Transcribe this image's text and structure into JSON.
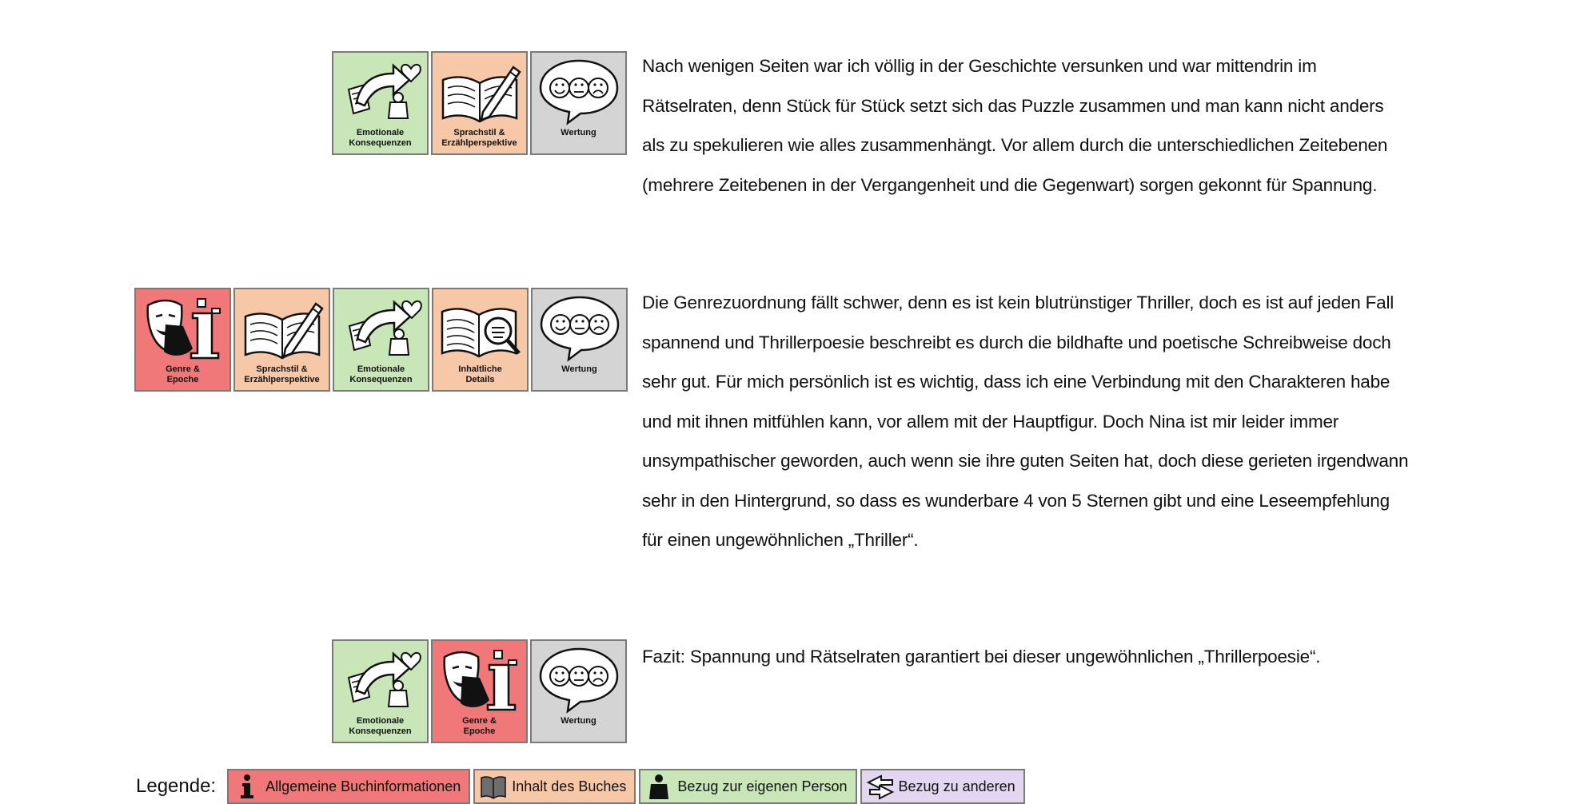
{
  "paragraphs": [
    {
      "text": "Nach wenigen Seiten war ich völlig in der Geschichte versunken und war mittendrin im Rätselraten, denn Stück für Stück setzt sich das Puzzle zusammen und man kann nicht anders als zu spekulieren wie alles zusammenhängt. Vor allem durch die unterschiedlichen Zeitebenen (mehrere Zeitebenen in der Vergangenheit und die Gegenwart) sorgen gekonnt für Spannung.",
      "icons": [
        {
          "icon": "emotion-arrow-icon",
          "label": "Emotionale\nKonsequenzen"
        },
        {
          "icon": "book-pen-icon",
          "label": "Sprachstil &\nErzählperspektive"
        },
        {
          "icon": "rating-faces-icon",
          "label": "Wertung"
        }
      ]
    },
    {
      "text": "Die Genrezuordnung fällt schwer, denn es ist kein blutrünstiger Thriller, doch es ist auf jeden Fall spannend und Thrillerpoesie beschreibt es durch die bildhafte und poetische Schreibweise doch sehr gut. Für mich persönlich ist es wichtig, dass ich eine Verbindung mit den Charakteren habe und mit ihnen mitfühlen kann, vor allem mit der Hauptfigur. Doch Nina ist mir leider immer unsympathischer geworden, auch wenn sie ihre guten Seiten hat, doch diese gerieten irgendwann sehr in den Hintergrund, so dass es wunderbare 4 von 5 Sternen gibt und eine Leseempfehlung für einen ungewöhnlichen „Thriller“.",
      "icons": [
        {
          "icon": "theater-mask-info-icon",
          "label": "Genre &\nEpoche"
        },
        {
          "icon": "book-pen-icon",
          "label": "Sprachstil &\nErzählperspektive"
        },
        {
          "icon": "emotion-arrow-icon",
          "label": "Emotionale\nKonsequenzen"
        },
        {
          "icon": "book-magnifier-icon",
          "label": "Inhaltliche\nDetails"
        },
        {
          "icon": "rating-faces-icon",
          "label": "Wertung"
        }
      ]
    },
    {
      "text": "Fazit: Spannung und Rätselraten garantiert bei dieser ungewöhnlichen „Thrillerpoesie“.",
      "icons": [
        {
          "icon": "emotion-arrow-icon",
          "label": "Emotionale\nKonsequenzen"
        },
        {
          "icon": "theater-mask-info-icon",
          "label": "Genre &\nEpoche"
        },
        {
          "icon": "rating-faces-icon",
          "label": "Wertung"
        }
      ]
    }
  ],
  "legend": {
    "title": "Legende:",
    "items": [
      {
        "icon": "info-icon",
        "label": "Allgemeine Buchinformationen",
        "color": "#f07878"
      },
      {
        "icon": "book-icon",
        "label": "Inhalt des Buches",
        "color": "#f7c8a8"
      },
      {
        "icon": "person-icon",
        "label": "Bezug zur eigenen Person",
        "color": "#c9e6b8"
      },
      {
        "icon": "arrows-icon",
        "label": "Bezug zu anderen",
        "color": "#e2d6f0"
      }
    ]
  },
  "colors": {
    "green": "#c9e6b8",
    "peach": "#f7c8a8",
    "gray": "#d4d4d4",
    "red": "#f07878"
  }
}
